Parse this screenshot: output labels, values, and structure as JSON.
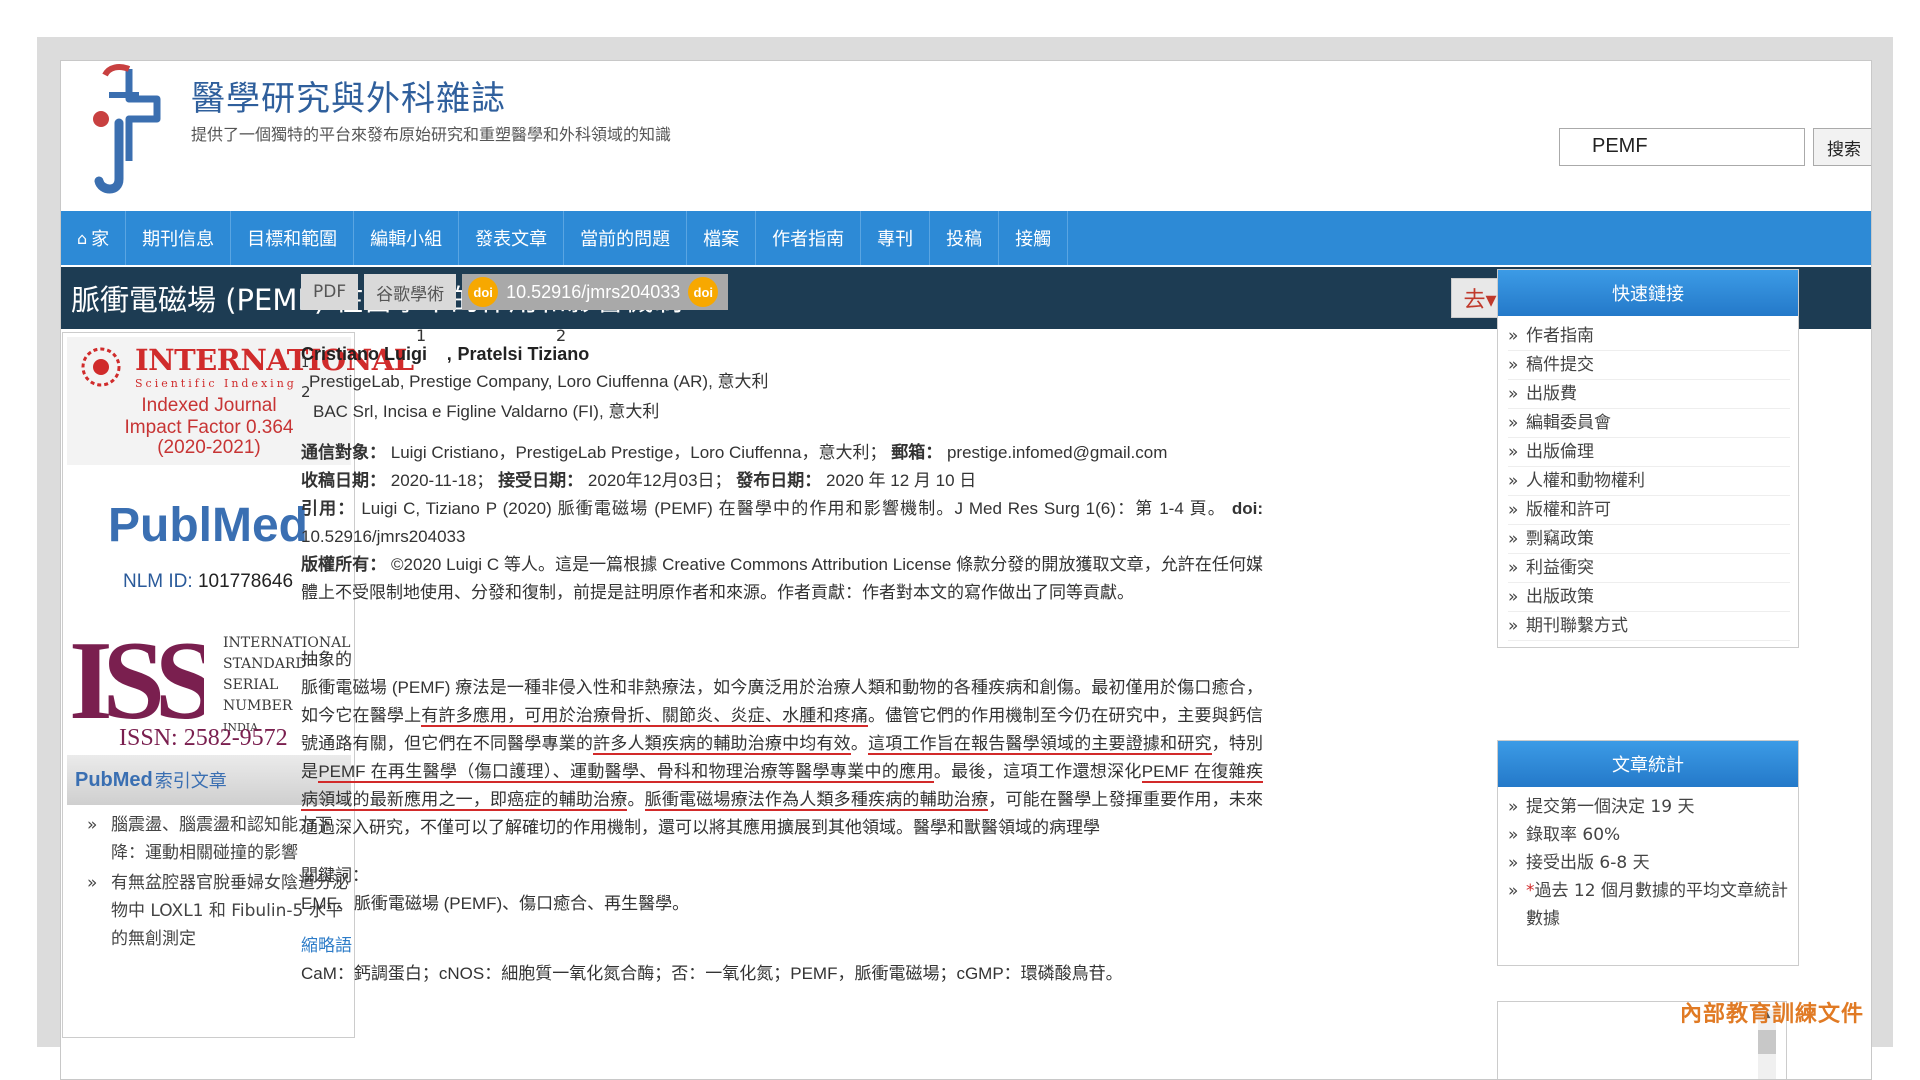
{
  "site": {
    "title": "醫學研究與外科雜誌",
    "subtitle": "提供了一個獨特的平台來發布原始研究和重塑醫學和外科領域的知識",
    "search_value": "PEMF",
    "search_button": "搜索"
  },
  "nav": {
    "items": [
      "家",
      "期刊信息",
      "目標和範圍",
      "編輯小組",
      "發表文章",
      "當前的問題",
      "檔案",
      "作者指南",
      "專刊",
      "投稿",
      "接觸"
    ]
  },
  "article": {
    "title": "脈衝電磁場 (PEMF) 在醫學中的作用和影響機制",
    "buttons": {
      "pdf": "PDF",
      "scholar": "谷歌學術",
      "doi": "10.52916/jmrs204033",
      "doi_badge": "doi",
      "go": "去▾"
    },
    "authors": {
      "a1": "Cristiano Luigi",
      "a1_sup": "1",
      "sep": ",",
      "a2": "Pratelsi Tiziano",
      "a2_sup": "2"
    },
    "affiliations": {
      "aff1_num": "1",
      "aff1": "PrestigeLab, Prestige Company, Loro Ciuffenna (AR), 意大利",
      "aff2_num": "2",
      "aff2": "BAC Srl, Incisa e Figline Valdarno (FI), 意大利"
    },
    "correspondence_label": "通信對象：",
    "correspondence": "Luigi Cristiano，PrestigeLab Prestige，Loro Ciuffenna，意大利；",
    "email_label": "郵箱：",
    "email": "prestige.infomed@gmail.com",
    "received_label": "收稿日期：",
    "received": "2020-11-18；",
    "accepted_label": "接受日期：",
    "accepted": "2020年12月03日；",
    "published_label": "發布日期：",
    "published": "2020 年 12 月 10 日",
    "citation_label": "引用：",
    "citation": "Luigi C, Tiziano P (2020) 脈衝電磁場 (PEMF) 在醫學中的作用和影響機制。J Med Res Surg 1(6)：第 1-4 頁。",
    "doi_label": "doi:",
    "doi_value": "10.52916/jmrs204033",
    "copyright_label": "版權所有：",
    "copyright": "©2020 Luigi C 等人。這是一篇根據 Creative Commons Attribution License 條款分發的開放獲取文章，允許在任何媒體上不受限制地使用、分發和復制，前提是註明原作者和來源。作者貢獻：作者對本文的寫作做出了同等貢獻。",
    "abstract_head": "抽象的",
    "abstract": {
      "p1": "脈衝電磁場 (PEMF) 療法是一種非侵入性和非熱療法，如今廣泛用於治療人類和動物的各種疾病和創傷。最初僅用於傷口癒合，如今它在醫學上",
      "u1": "有許多應用，可用於治療骨折、關節炎、炎症、水腫和疼痛",
      "p2": "。儘管它們的作用機制至今仍在研究中，主要與鈣信號通路有關，但它們在不同醫學專業的",
      "u2": "許多人類疾病的輔助治療中均有效",
      "p3": "。",
      "u3": "這項工作旨在報告醫學領域的主要證據和研究",
      "p4": "，特別是",
      "u4": "PEMF 在再生醫學（傷口護理）、運動醫學、骨科和物理治療等醫學專業中的應用",
      "p5": "。最後，這項工作還想深化",
      "u5": "PEMF 在復雜疾病領域的最新應用之一，即癌症的輔助治療",
      "p6": "。",
      "u6": "脈衝電磁場療法作為人類多種疾病的輔助治療",
      "p7": "，可能在醫學上發揮重要作用，未來通過深入研究，不僅可以了解確切的作用機制，還可以將其應用擴展到其他領域。醫學和獸醫領域的病理學"
    },
    "keywords_head": "關鍵詞：",
    "keywords": "EMF、脈衝電磁場 (PEMF)、傷口癒合、再生醫學。",
    "abbr_head": "縮略語",
    "abbr": "CaM：鈣調蛋白；cNOS：細胞質一氧化氮合酶；否：一氧化氮；PEMF，脈衝電磁場；cGMP：環磷酸鳥苷。"
  },
  "left": {
    "intl_word": "INTERNATIONAL",
    "intl_sub": "Scientific Indexing",
    "intl_l1": "Indexed Journal",
    "intl_l2": "Impact Factor 0.364",
    "intl_l3": "(2020-2021)",
    "pubmed_pub": "Publ",
    "pubmed_med": "Med",
    "nlm_label": "NLM ID:",
    "nlm_value": "101778646",
    "issn_letters": "ISSN",
    "issn_text": [
      "INTERNATIONAL",
      "STANDARD",
      "SERIAL",
      "NUMBER",
      "INDIA"
    ],
    "issn_num": "ISSN: 2582-9572",
    "index_pubmed": "PubMed",
    "index_label": "索引文章",
    "index_items": [
      "腦震盪、腦震盪和認知能力下降：運動相關碰撞的影響",
      "有無盆腔器官脫垂婦女陰道分泌物中 LOXL1 和 Fibulin-5 水平的無創測定"
    ]
  },
  "right": {
    "quick_head": "快速鏈接",
    "quick_links": [
      "作者指南",
      "稿件提交",
      "出版費",
      "編輯委員會",
      "出版倫理",
      "人權和動物權利",
      "版權和許可",
      "剽竊政策",
      "利益衝突",
      "出版政策",
      "期刊聯繫方式"
    ],
    "stats_head": "文章統計",
    "stats": [
      "提交第一個決定 19 天",
      "錄取率 60%",
      "接受出版 6-8 天"
    ],
    "stats_star": "*",
    "stats_last": "過去 12 個月數據的平均文章統計數據"
  },
  "watermark": "內部教育訓練文件",
  "colors": {
    "nav": "#2d8ad6",
    "title_bar": "#1d3c53",
    "underline": "#d22a2a",
    "panel_head": "#2479c9"
  }
}
